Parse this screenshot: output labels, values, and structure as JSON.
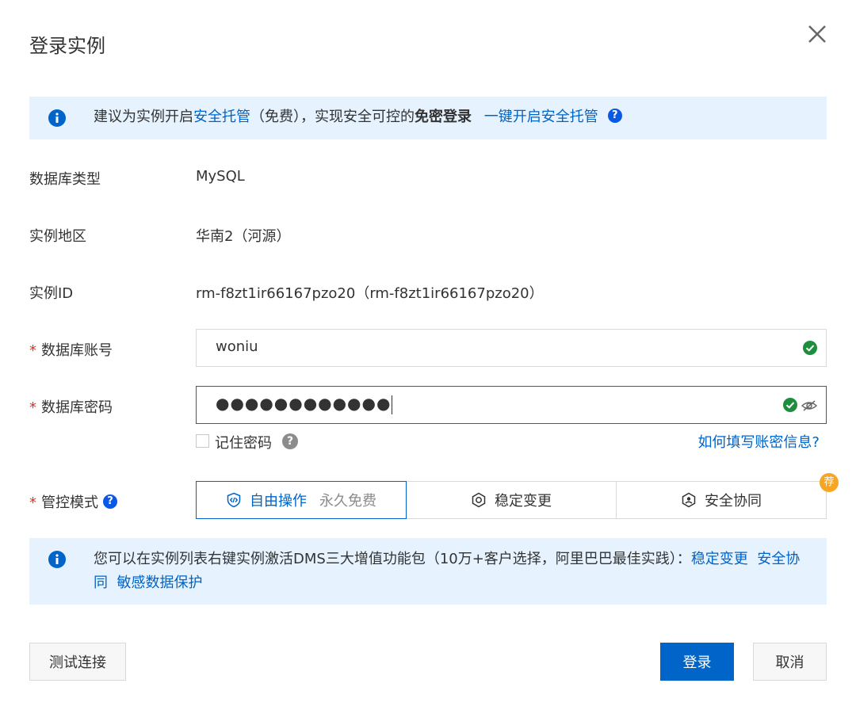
{
  "dialog": {
    "title": "登录实例"
  },
  "notice_top": {
    "text_prefix": "建议为实例开启",
    "link_managed": "安全托管",
    "text_middle": "（免费），实现安全可控的",
    "bold_text": "免密登录",
    "link_enable": "一键开启安全托管"
  },
  "fields": {
    "db_type_label": "数据库类型",
    "db_type_value": "MySQL",
    "region_label": "实例地区",
    "region_value": "华南2（河源）",
    "instance_id_label": "实例ID",
    "instance_id_value": "rm-f8zt1ir66167pzo20（rm-f8zt1ir66167pzo20）",
    "required_mark": "*",
    "account_label": "数据库账号",
    "account_value": "woniu",
    "password_label": "数据库密码",
    "password_masked": "●●●●●●●●●●●●",
    "remember_label": "记住密码",
    "howto_link": "如何填写账密信息?"
  },
  "control_mode": {
    "label": "管控模式",
    "options": [
      {
        "label": "自由操作",
        "sub": "永久免费"
      },
      {
        "label": "稳定变更"
      },
      {
        "label": "安全协同"
      }
    ],
    "recommend_badge": "荐"
  },
  "notice_bottom": {
    "text": "您可以在实例列表右键实例激活DMS三大增值功能包（10万+客户选择，阿里巴巴最佳实践）：",
    "link1": "稳定变更",
    "link2": "安全协同",
    "link3": "敏感数据保护"
  },
  "footer": {
    "test_label": "测试连接",
    "login_label": "登录",
    "cancel_label": "取消"
  },
  "colors": {
    "primary": "#0064c8",
    "notice_bg": "#e6f3ff",
    "success": "#1e8e3e",
    "required": "#d93026",
    "badge": "#f6a623"
  }
}
